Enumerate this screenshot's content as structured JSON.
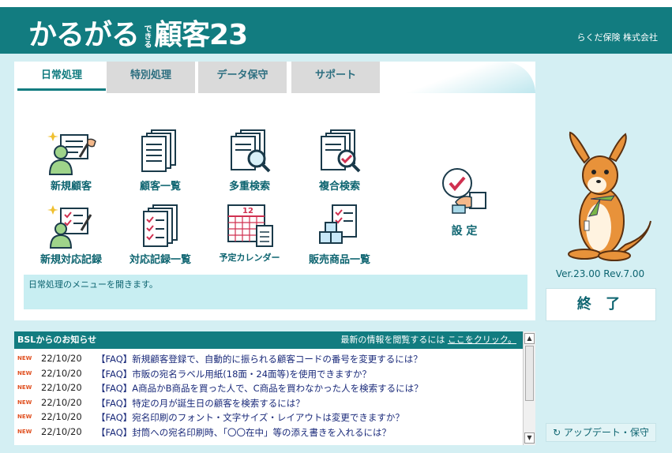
{
  "header": {
    "logo_main": "かるがる",
    "logo_small": "できる",
    "logo_suffix": "顧客23",
    "company": "らくだ保険 株式会社"
  },
  "tabs": [
    {
      "label": "日常処理",
      "active": true
    },
    {
      "label": "特別処理",
      "active": false
    },
    {
      "label": "データ保守",
      "active": false
    },
    {
      "label": "サポート",
      "active": false
    }
  ],
  "menu": {
    "new_customer": "新規顧客",
    "customer_list": "顧客一覧",
    "multi_search": "多重検索",
    "combined_search": "複合検索",
    "new_record": "新規対応記録",
    "record_list": "対応記録一覧",
    "calendar": "予定カレンダー",
    "calendar_number": "12",
    "product_list": "販売商品一覧",
    "settings": "設 定"
  },
  "description": "日常処理のメニューを開きます。",
  "version": "Ver.23.00 Rev.7.00",
  "end_button": "終 了",
  "update_button": "↻ アップデート・保守",
  "news": {
    "title": "BSLからのお知らせ",
    "link_prefix": "最新の情報を閲覧するには",
    "link_text": "ここをクリック。",
    "items": [
      {
        "badge": "NEW",
        "date": "22/10/20",
        "text": "【FAQ】新規顧客登録で、自動的に振られる顧客コードの番号を変更するには？"
      },
      {
        "badge": "NEW",
        "date": "22/10/20",
        "text": "【FAQ】市販の宛名ラベル用紙(18面・24面等)を使用できますか？"
      },
      {
        "badge": "NEW",
        "date": "22/10/20",
        "text": "【FAQ】A商品かB商品を買った人で、C商品を買わなかった人を検索するには？"
      },
      {
        "badge": "NEW",
        "date": "22/10/20",
        "text": "【FAQ】特定の月が誕生日の顧客を検索するには？"
      },
      {
        "badge": "NEW",
        "date": "22/10/20",
        "text": "【FAQ】宛名印刷のフォント・文字サイズ・レイアウトは変更できますか？"
      },
      {
        "badge": "NEW",
        "date": "22/10/20",
        "text": "【FAQ】封筒への宛名印刷時、「〇〇在中」等の添え書きを入れるには？"
      }
    ]
  },
  "colors": {
    "brand": "#127c80",
    "background": "#d4eff3",
    "new_badge": "#e05020",
    "kangaroo": "#e8923a"
  }
}
